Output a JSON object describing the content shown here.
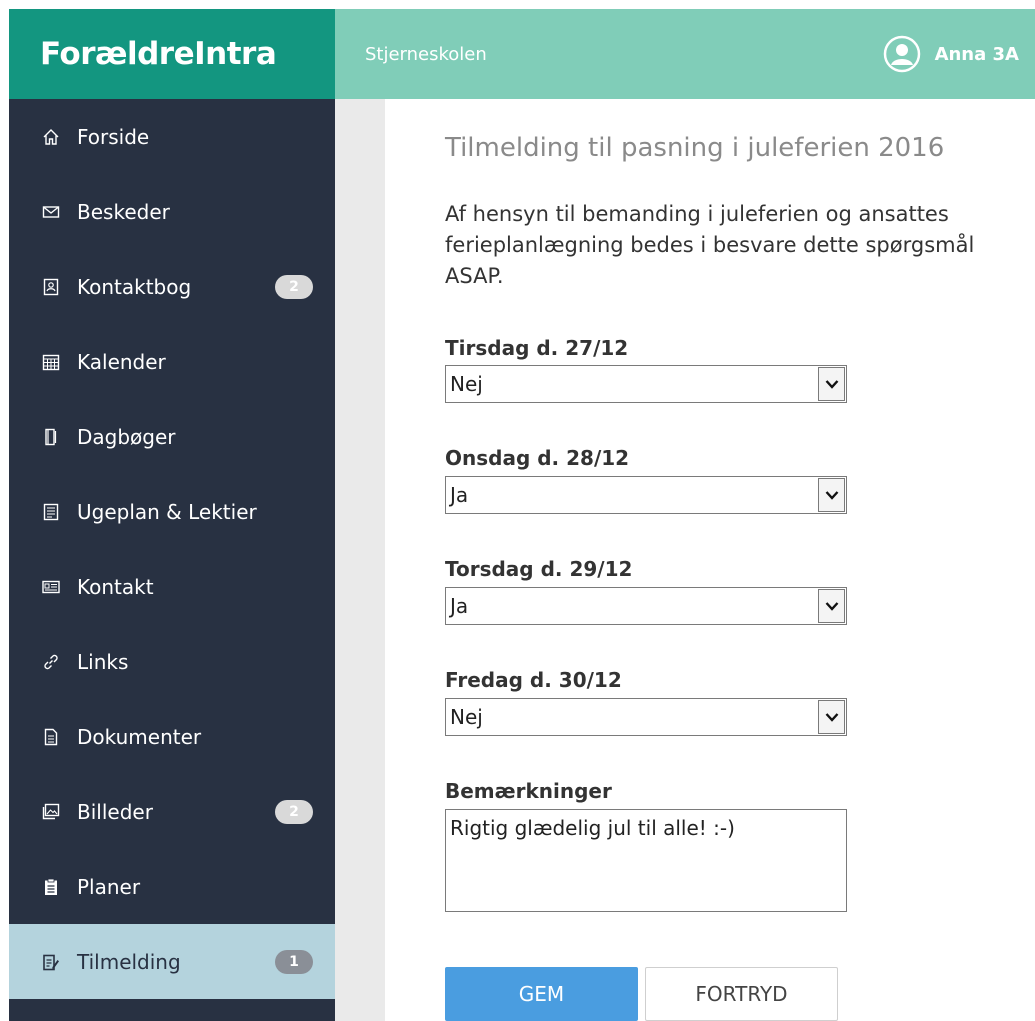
{
  "header": {
    "brand": "ForældreIntra",
    "school": "Stjerneskolen",
    "user": "Anna 3A"
  },
  "sidebar": {
    "items": [
      {
        "label": "Forside",
        "icon": "home-icon"
      },
      {
        "label": "Beskeder",
        "icon": "mail-icon"
      },
      {
        "label": "Kontaktbog",
        "icon": "contact-book-icon",
        "badge": "2"
      },
      {
        "label": "Kalender",
        "icon": "calendar-icon"
      },
      {
        "label": "Dagbøger",
        "icon": "diary-icon"
      },
      {
        "label": "Ugeplan & Lektier",
        "icon": "weekplan-icon"
      },
      {
        "label": "Kontakt",
        "icon": "contact-card-icon"
      },
      {
        "label": "Links",
        "icon": "link-icon"
      },
      {
        "label": "Dokumenter",
        "icon": "document-icon"
      },
      {
        "label": "Billeder",
        "icon": "images-icon",
        "badge": "2"
      },
      {
        "label": "Planer",
        "icon": "clipboard-icon"
      },
      {
        "label": "Tilmelding",
        "icon": "signup-icon",
        "badge": "1",
        "active": true
      }
    ]
  },
  "form": {
    "title": "Tilmelding til pasning i juleferien 2016",
    "intro": "Af hensyn til bemanding i juleferien og ansattes ferieplanlægning bedes i besvare dette spørgsmål ASAP.",
    "fields": [
      {
        "label": "Tirsdag d. 27/12",
        "value": "Nej"
      },
      {
        "label": "Onsdag d. 28/12",
        "value": "Ja"
      },
      {
        "label": "Torsdag d. 29/12",
        "value": "Ja"
      },
      {
        "label": "Fredag d. 30/12",
        "value": "Nej"
      }
    ],
    "remarks_label": "Bemærkninger",
    "remarks_value": "Rigtig glædelig jul til alle! :-)",
    "save_label": "GEM",
    "cancel_label": "FORTRYD"
  },
  "colors": {
    "brand": "#139680",
    "topbar": "#80cdb8",
    "sidebar": "#283142",
    "active": "#b4d3dd",
    "primary_button": "#4a9de0"
  }
}
